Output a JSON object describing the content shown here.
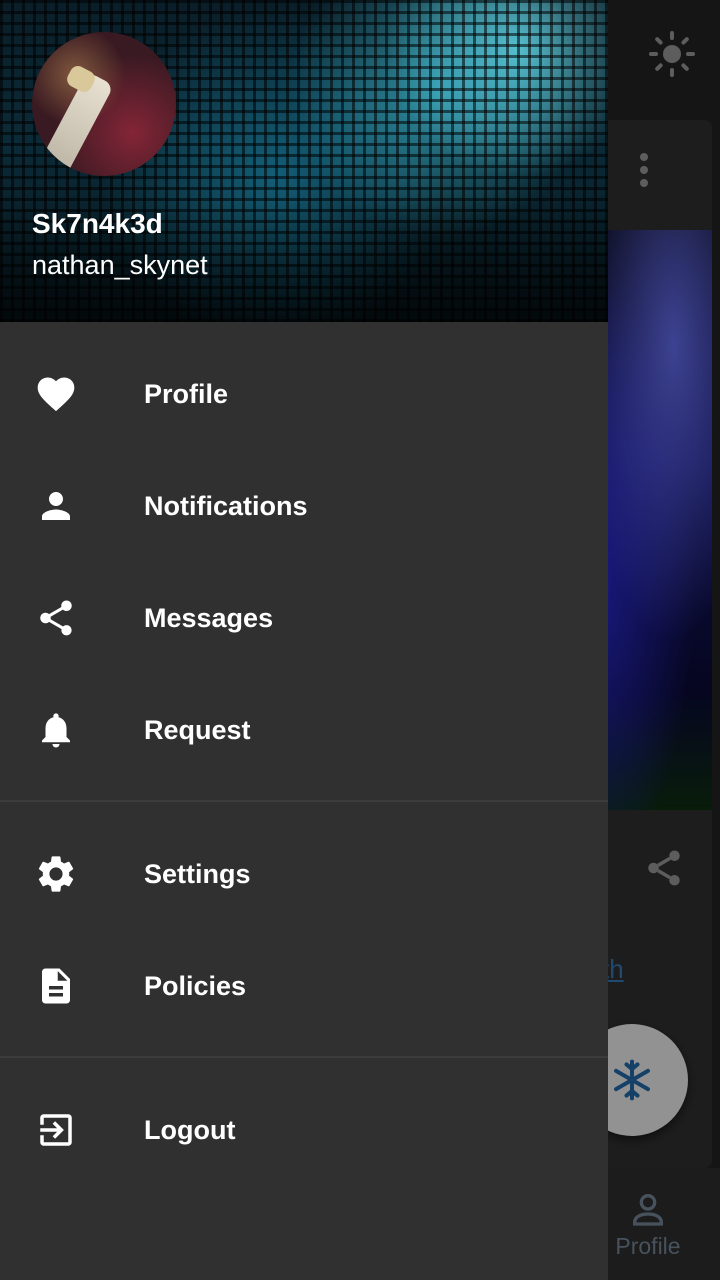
{
  "user": {
    "display_name": "Sk7n4k3d",
    "username": "nathan_skynet"
  },
  "drawer": {
    "primary_items": [
      {
        "label": "Profile",
        "icon": "heart-icon"
      },
      {
        "label": "Notifications",
        "icon": "person-icon"
      },
      {
        "label": "Messages",
        "icon": "share-icon"
      },
      {
        "label": "Request",
        "icon": "bell-icon"
      }
    ],
    "secondary_items": [
      {
        "label": "Settings",
        "icon": "gear-icon"
      },
      {
        "label": "Policies",
        "icon": "document-icon"
      }
    ],
    "logout": {
      "label": "Logout",
      "icon": "logout-icon"
    }
  },
  "background": {
    "card_link_text": "th",
    "bottom_nav": {
      "label": "Profile",
      "icon": "person-outline-icon"
    },
    "fab_icon": "snowflake-icon",
    "theme_icon": "sun-icon"
  },
  "colors": {
    "drawer_bg": "#303030",
    "text": "#ffffff",
    "link": "#2f6fa8",
    "fab_icon": "#1f5f9a"
  }
}
